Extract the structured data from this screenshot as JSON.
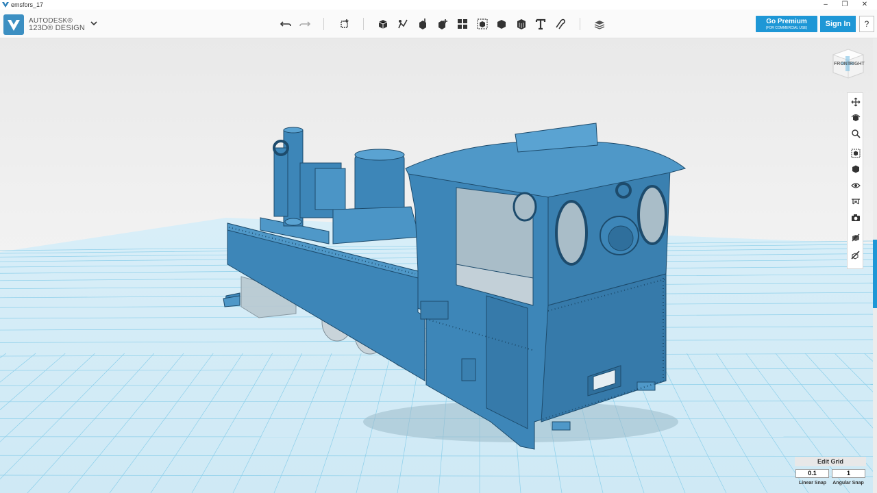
{
  "window": {
    "title": "emsfors_17",
    "minimize": "–",
    "maximize": "❐",
    "close": "✕"
  },
  "brand": {
    "vendor": "AUTODESK®",
    "product": "123D® DESIGN",
    "menu_icon": "chevron-down-icon",
    "color": "#3c8fc2"
  },
  "toolbar": {
    "tools": [
      "undo-icon",
      "redo-icon",
      "transform-icon",
      "primitives-icon",
      "sketch-icon",
      "construct-icon",
      "modify-icon",
      "pattern-icon",
      "grouping-icon",
      "combine-icon",
      "measure-icon",
      "text-icon",
      "snap-icon",
      "material-icon"
    ]
  },
  "account": {
    "premium_label": "Go Premium",
    "premium_sub": "(FOR COMMERCIAL USE)",
    "signin_label": "Sign In",
    "help_label": "?",
    "accent": "#1e97d6"
  },
  "viewcube": {
    "front": "FRONT",
    "right": "RIGHT"
  },
  "navbar": {
    "tools": [
      "pan-icon",
      "orbit-icon",
      "zoom-icon",
      "fit-icon",
      "view-cube-icon",
      "visibility-icon",
      "material-display-icon",
      "camera-icon",
      "snap-grid-icon",
      "ruler-icon"
    ]
  },
  "grid": {
    "edit_label": "Edit Grid",
    "linear_snap_value": "0.1",
    "angular_snap_value": "1",
    "linear_snap_label": "Linear Snap",
    "angular_snap_label": "Angular Snap"
  },
  "model": {
    "color": "#3d86b8",
    "grid_color": "#7cc6e6"
  }
}
